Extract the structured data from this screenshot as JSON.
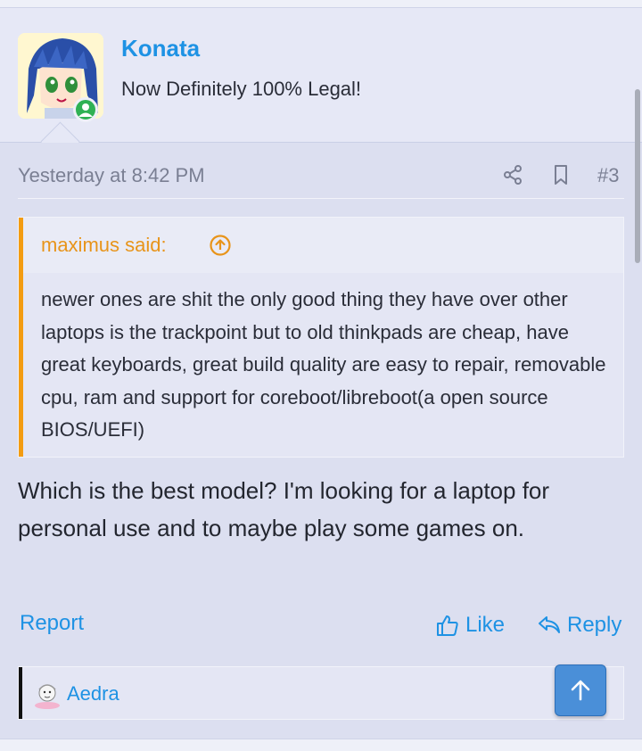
{
  "author": {
    "name": "Konata",
    "title": "Now Definitely 100% Legal!"
  },
  "post": {
    "date": "Yesterday at 8:42 PM",
    "number": "#3",
    "quote": {
      "author": "maximus said:",
      "text": "newer ones are shit the only good thing they have over other laptops is the trackpoint but to old thinkpads are cheap, have great keyboards, great build quality are easy to repair, removable cpu, ram and support for coreboot/libreboot(a open source BIOS/UEFI)"
    },
    "message": "Which is the best model? I'm looking for a laptop for personal use and to maybe play some games on."
  },
  "actions": {
    "report": "Report",
    "like": "Like",
    "reply": "Reply"
  },
  "reactions": {
    "users": [
      "Aedra"
    ]
  },
  "colors": {
    "accent": "#1e92e4",
    "quote_accent": "#f39c12",
    "online": "#2fb154",
    "scroll_button": "#4a8fd8"
  },
  "icons": [
    "share-icon",
    "bookmark-icon",
    "arrow-up-circle-icon",
    "thumbs-up-icon",
    "reply-icon",
    "arrow-up-icon"
  ]
}
